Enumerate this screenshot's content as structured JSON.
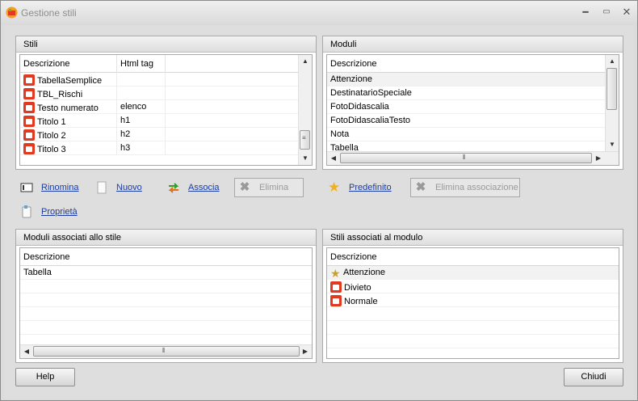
{
  "window": {
    "title": "Gestione stili",
    "controls": [
      "minimize",
      "maximize",
      "close"
    ]
  },
  "stili": {
    "header": "Stili",
    "columns": [
      "Descrizione",
      "Html tag"
    ],
    "rows": [
      {
        "name": "TabellaSemplice",
        "tag": ""
      },
      {
        "name": "TBL_Rischi",
        "tag": ""
      },
      {
        "name": "Testo numerato",
        "tag": "elenco"
      },
      {
        "name": "Titolo 1",
        "tag": "h1"
      },
      {
        "name": "Titolo 2",
        "tag": "h2"
      },
      {
        "name": "Titolo 3",
        "tag": "h3"
      }
    ]
  },
  "moduli": {
    "header": "Moduli",
    "columns": [
      "Descrizione"
    ],
    "rows": [
      "Attenzione",
      "DestinatarioSpeciale",
      "FotoDidascalia",
      "FotoDidascaliaTesto",
      "Nota",
      "Tabella"
    ]
  },
  "actions": {
    "rinomina": "Rinomina",
    "nuovo": "Nuovo",
    "associa": "Associa",
    "elimina": "Elimina",
    "predefinito": "Predefinito",
    "elimina_associazione": "Elimina associazione",
    "proprieta": "Proprietà"
  },
  "moduli_associati": {
    "header": "Moduli associati allo stile",
    "columns": [
      "Descrizione"
    ],
    "rows": [
      "Tabella"
    ]
  },
  "stili_associati": {
    "header": "Stili associati al modulo",
    "columns": [
      "Descrizione"
    ],
    "rows": [
      {
        "name": "Attenzione",
        "icon": "default-style-icon"
      },
      {
        "name": "Divieto",
        "icon": "style-icon"
      },
      {
        "name": "Normale",
        "icon": "style-icon"
      }
    ]
  },
  "footer": {
    "help": "Help",
    "close": "Chiudi"
  }
}
